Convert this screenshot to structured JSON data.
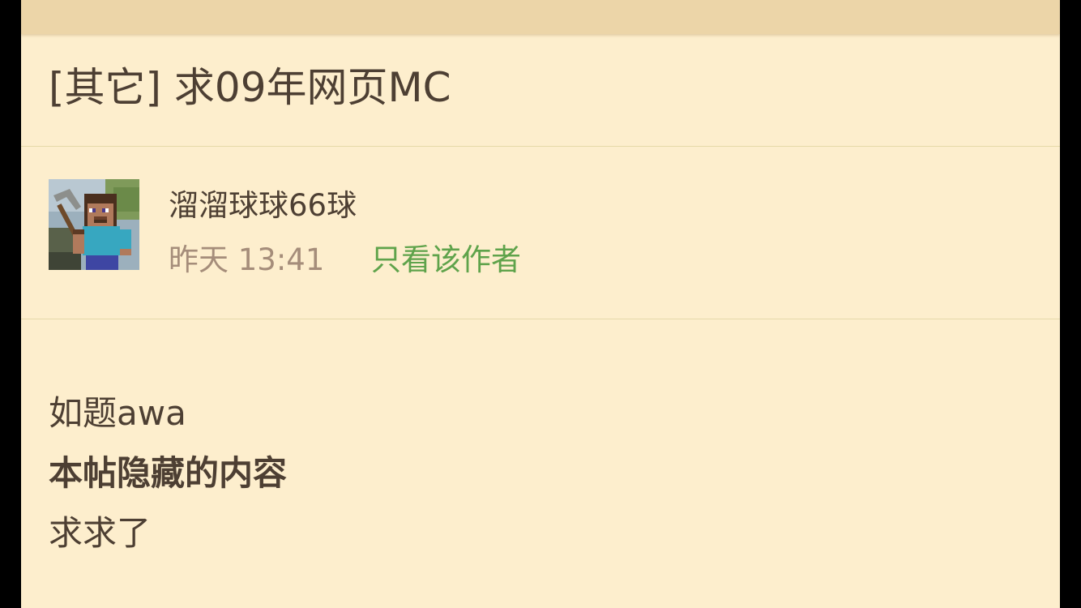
{
  "thread": {
    "title": "[其它] 求09年网页MC"
  },
  "author": {
    "name": "溜溜球球66球",
    "time": "昨天 13:41",
    "only_author_label": "只看该作者",
    "avatar_icon": "minecraft-steve-avatar"
  },
  "post": {
    "lines": [
      {
        "text": "如题awa"
      },
      {
        "text": "本帖隐藏的内容"
      },
      {
        "text": "求求了"
      }
    ]
  },
  "colors": {
    "page_background": "#fdeecd",
    "top_bar": "#ecd5a8",
    "text": "#4d3f33",
    "muted_text": "#a58d7a",
    "link_green": "#5fa34b",
    "divider": "#e6d9a9"
  }
}
